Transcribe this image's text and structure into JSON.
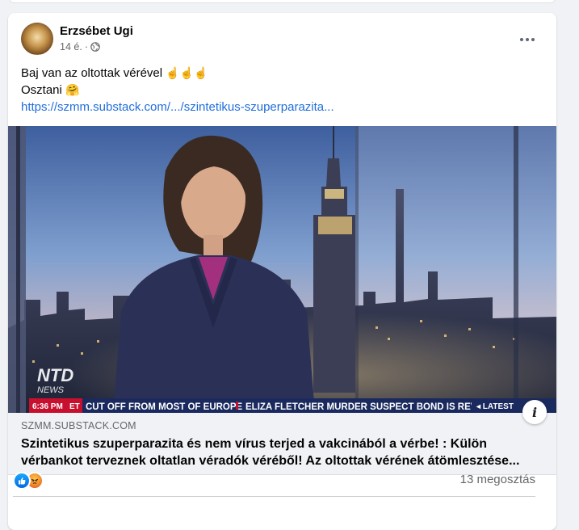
{
  "post": {
    "author_name": "Erzsébet Ugi",
    "time": "14 é.",
    "separator": "·",
    "privacy_icon": "globe-icon",
    "more_icon": "more-options-icon",
    "text_line1": "Baj van az oltottak vérével",
    "text_line1_emoji": "☝️☝️☝️",
    "text_line2": "Osztani",
    "text_line2_emoji": "🤗",
    "link_text": "https://szmm.substack.com/.../szintetikus-szuperparazita..."
  },
  "video": {
    "time": "6:36 PM",
    "timezone": "ET",
    "ticker_1": "CUT OFF FROM MOST OF EUROPE",
    "ticker_2": "ELIZA FLETCHER MURDER SUSPECT BOND IS REV",
    "latest": "◂ LATEST",
    "logo_top": "NTD",
    "logo_bottom": "NEWS"
  },
  "preview": {
    "domain": "SZMM.SUBSTACK.COM",
    "headline": "Szintetikus szuperparazita és nem vírus terjed a vakcinából a vérbe! : Külön vérbankot terveznek oltatlan véradók véréből! Az oltottak vérének átömlesztése...",
    "info_icon": "i"
  },
  "footer": {
    "reactions": [
      "like-icon",
      "angry-icon"
    ],
    "shares": "13 megosztás"
  },
  "colors": {
    "link": "#216fdb",
    "ticker_bg": "#1b2a5e",
    "ticker_red": "#c8102e"
  }
}
